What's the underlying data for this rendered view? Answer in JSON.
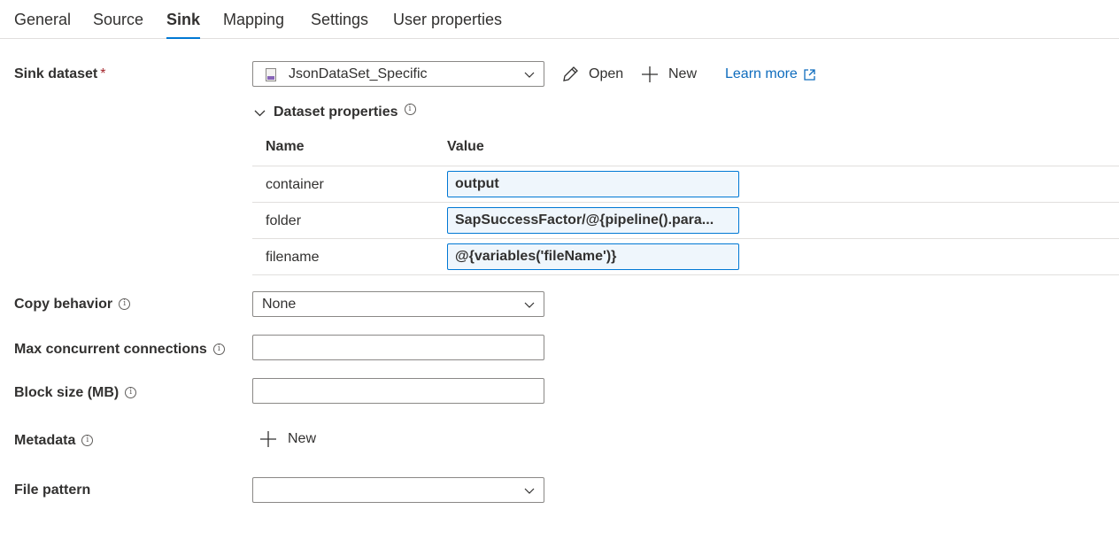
{
  "tabs": [
    {
      "label": "General",
      "active": false
    },
    {
      "label": "Source",
      "active": false
    },
    {
      "label": "Sink",
      "active": true
    },
    {
      "label": "Mapping",
      "active": false
    },
    {
      "label": "Settings",
      "active": false
    },
    {
      "label": "User properties",
      "active": false
    }
  ],
  "sink_dataset": {
    "label": "Sink dataset",
    "required_mark": "*",
    "value": "JsonDataSet_Specific",
    "open_label": "Open",
    "new_label": "New",
    "learn_more_label": "Learn more"
  },
  "dataset_properties": {
    "title": "Dataset properties",
    "info_icon": "i",
    "col_name": "Name",
    "col_value": "Value",
    "rows": [
      {
        "name": "container",
        "value": "output"
      },
      {
        "name": "folder",
        "value": "SapSuccessFactor/@{pipeline().para..."
      },
      {
        "name": "filename",
        "value": "@{variables('fileName')}"
      }
    ]
  },
  "copy_behavior": {
    "label": "Copy behavior",
    "value": "None"
  },
  "max_concurrent": {
    "label": "Max concurrent connections",
    "value": ""
  },
  "block_size": {
    "label": "Block size (MB)",
    "value": ""
  },
  "metadata": {
    "label": "Metadata",
    "new_label": "New"
  },
  "file_pattern": {
    "label": "File pattern",
    "value": ""
  },
  "colors": {
    "accent": "#0078d4",
    "link": "#0f6cbd",
    "required": "#a4262c"
  }
}
